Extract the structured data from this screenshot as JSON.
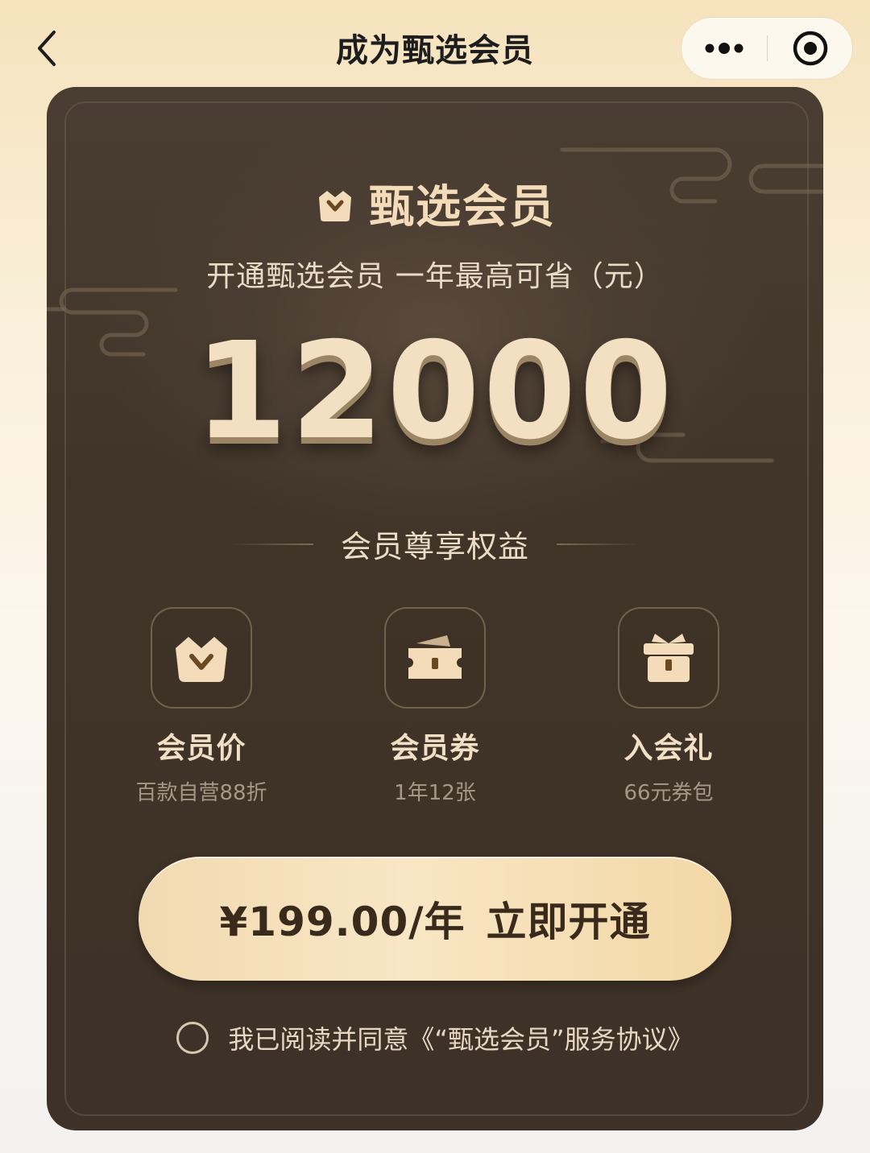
{
  "nav": {
    "back_icon": "chevron-left-icon",
    "title": "成为甄选会员",
    "more_icon": "more-dots-icon",
    "close_icon": "target-close-icon"
  },
  "card": {
    "brand_icon": "crown-bag-icon",
    "brand_name": "甄选会员",
    "subtitle": "开通甄选会员 一年最高可省（元）",
    "savings_amount": "12000",
    "benefits_title": "会员尊享权益",
    "benefits": [
      {
        "icon": "crown-bag-icon",
        "title": "会员价",
        "desc": "百款自营88折"
      },
      {
        "icon": "ticket-icon",
        "title": "会员券",
        "desc": "1年12张"
      },
      {
        "icon": "gift-box-icon",
        "title": "入会礼",
        "desc": "66元券包"
      }
    ],
    "cta": {
      "price": "¥199.00/年",
      "action": "立即开通"
    },
    "agreement": {
      "prefix": "我已阅读并同意",
      "link": "《“甄选会员”服务协议》",
      "checked": false
    }
  },
  "colors": {
    "card_bg": "#403428",
    "accent_gold": "#f3dfc2",
    "cta_bg": "#f6e2bc",
    "cta_text": "#3a2a1c"
  }
}
